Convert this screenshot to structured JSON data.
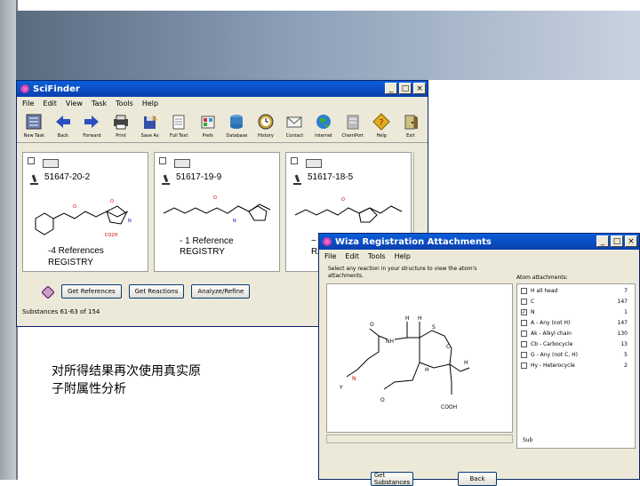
{
  "main_window": {
    "title": "SciFinder",
    "controls": [
      "_",
      "□",
      "×"
    ],
    "menu": [
      "File",
      "Edit",
      "View",
      "Task",
      "Tools",
      "Help"
    ],
    "toolbar": [
      {
        "label": "New Task",
        "icon": "new-task-icon"
      },
      {
        "label": "Back",
        "icon": "back-arrow-icon"
      },
      {
        "label": "Forward",
        "icon": "forward-arrow-icon"
      },
      {
        "label": "Print",
        "icon": "printer-icon"
      },
      {
        "label": "Save As",
        "icon": "save-as-icon"
      },
      {
        "label": "Full Text",
        "icon": "full-text-icon"
      },
      {
        "label": "Prefs",
        "icon": "prefs-icon"
      },
      {
        "label": "Database",
        "icon": "database-icon"
      },
      {
        "label": "History",
        "icon": "history-icon"
      },
      {
        "label": "Contact",
        "icon": "envelope-icon"
      },
      {
        "label": "Internet",
        "icon": "globe-icon"
      },
      {
        "label": "ChemPort",
        "icon": "chemport-icon"
      },
      {
        "label": "Help",
        "icon": "help-icon"
      },
      {
        "label": "Exit",
        "icon": "exit-icon"
      }
    ],
    "results": [
      {
        "regno": "51647-20-2",
        "refs": "-4 References",
        "registry": "REGISTRY"
      },
      {
        "regno": "51617-19-9",
        "refs": "- 1 Reference",
        "registry": "REGISTRY"
      },
      {
        "regno": "51617-18-5",
        "refs": "~",
        "registry": "RA"
      }
    ],
    "buttons": [
      "Get References",
      "Get Reactions",
      "Analyze/Refine"
    ],
    "status": "Substances 61-63 of 154"
  },
  "attach_window": {
    "title": "Wiza Registration Attachments",
    "controls": [
      "_",
      "□",
      "×"
    ],
    "menu": [
      "File",
      "Edit",
      "Tools",
      "Help"
    ],
    "instruction": "Select any reaction in your structure to view the atom's attachments.",
    "panel_title": "Atom attachments:",
    "attachments": [
      {
        "label": "H  all head",
        "count": "7",
        "checked": false
      },
      {
        "label": "C",
        "count": "147",
        "checked": false
      },
      {
        "label": "N",
        "count": "1",
        "checked": true
      },
      {
        "label": "A - Any (not H)",
        "count": "147",
        "checked": false
      },
      {
        "label": "Ak - Alkyl chain",
        "count": "130",
        "checked": false
      },
      {
        "label": "Cb - Carbocycle",
        "count": "13",
        "checked": false
      },
      {
        "label": "G - Any (not C, H)",
        "count": "5",
        "checked": false
      },
      {
        "label": "Hy - Heterocycle",
        "count": "2",
        "checked": false
      }
    ],
    "panel_footer": "Sub",
    "buttons": [
      "Get Substances",
      "Back"
    ]
  },
  "caption": [
    "对所得结果再次使用真实原",
    "子附属性分析"
  ]
}
